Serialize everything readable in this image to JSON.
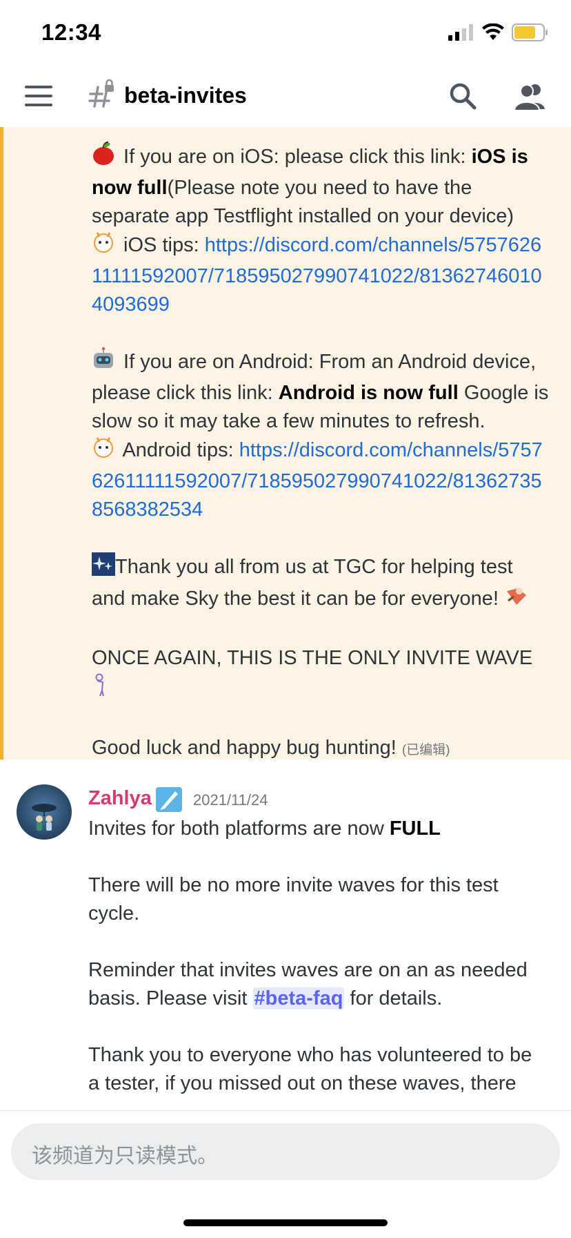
{
  "status_bar": {
    "time": "12:34"
  },
  "header": {
    "channel_name": "beta-invites"
  },
  "message1": {
    "ios_line_prefix": " If you are on iOS: please click this link: ",
    "ios_full": "iOS is now full",
    "ios_note": "(Please note you need to have the separate app Testflight installed on your device)",
    "ios_tips_label": " iOS tips: ",
    "ios_tips_link": "https://discord.com/channels/575762611111592007/718595027990741022/813627460104093699",
    "android_prefix": " If you are on Android: From an Android device, please click this link: ",
    "android_full": "Android is now full",
    "android_suffix": "  Google is slow so it may take a few minutes to refresh.",
    "android_tips_label": " Android tips: ",
    "android_tips_link": "https://discord.com/channels/575762611111592007/718595027990741022/813627358568382534",
    "thanks": "Thank you all from us at TGC for helping test and make Sky the best it can be for everyone! ",
    "once_again": "ONCE AGAIN, THIS IS THE ONLY INVITE WAVE",
    "good_luck": "Good luck and happy bug hunting!",
    "edited_label": "(已编辑)"
  },
  "message2": {
    "author": "Zahlya",
    "timestamp": "2021/11/24",
    "line1_prefix": "Invites for both platforms are now ",
    "line1_bold": "FULL",
    "para2": "There will be no more invite waves for this test cycle.",
    "para3_prefix": "Reminder that invites waves are on an as needed basis. Please visit ",
    "para3_channel": "#beta-faq",
    "para3_suffix": " for details.",
    "para4": "Thank you to everyone who has volunteered to be a tester, if you missed out on these waves, there"
  },
  "composer": {
    "placeholder": "该频道为只读模式。"
  },
  "colors": {
    "mention_bg": "#fdf4e6",
    "mention_bar": "#f0b132",
    "link": "#1e6bd6",
    "author": "#d63c6b",
    "channel_mention": "#5865f2"
  },
  "icons": [
    "hamburger-icon",
    "locked-hash-icon",
    "search-icon",
    "members-icon",
    "apple-emoji",
    "tips-emoji",
    "robot-emoji",
    "sparkle-emoji",
    "flying-emoji",
    "bowing-emoji",
    "role-icon"
  ]
}
